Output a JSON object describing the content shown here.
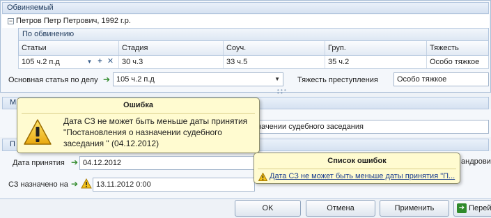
{
  "accused": {
    "section_title": "Обвиняемый",
    "person": "Петров Петр Петрович, 1992 г.р.",
    "charge_group": "По обвинению",
    "columns": [
      "Статьи",
      "Стадия",
      "Соуч.",
      "Груп.",
      "Тяжесть"
    ],
    "row": {
      "article": "105 ч.2 п.д",
      "stage": "30 ч.3",
      "complicity": "33 ч.5",
      "group": "35 ч.2",
      "severity": "Особо тяжкое"
    },
    "main_article_label": "Основная статья по делу",
    "main_article_value": "105 ч.2 п.д",
    "severity_label": "Тяжесть преступления",
    "severity_value": "Особо тяжкое"
  },
  "middle": {
    "strip_initial": "М",
    "ruling_text_suffix": "начении судебного заседания",
    "decision_strip_initial": "П"
  },
  "dates": {
    "accept_label": "Дата принятия",
    "accept_value": "04.12.2012",
    "hearing_label": "СЗ назначено на",
    "hearing_value": "13.11.2012 0:00",
    "right_cut_text": "андрови"
  },
  "error_tooltip": {
    "title": "Ошибка",
    "message": "Дата СЗ не может быть меньше даты принятия \"Постановления о назначении судебного заседания \" (04.12.2012)"
  },
  "error_list": {
    "title": "Список ошибок",
    "item": "Дата СЗ не может быть меньше даты принятия \"П..."
  },
  "buttons": {
    "ok": "OK",
    "cancel": "Отмена",
    "apply": "Применить",
    "next": "Перей"
  },
  "colors": {
    "accent_blue": "#1e395b",
    "tooltip_bg": "#fffbd0",
    "warning_yellow": "#f3c21b",
    "go_green": "#2f8a2a"
  }
}
